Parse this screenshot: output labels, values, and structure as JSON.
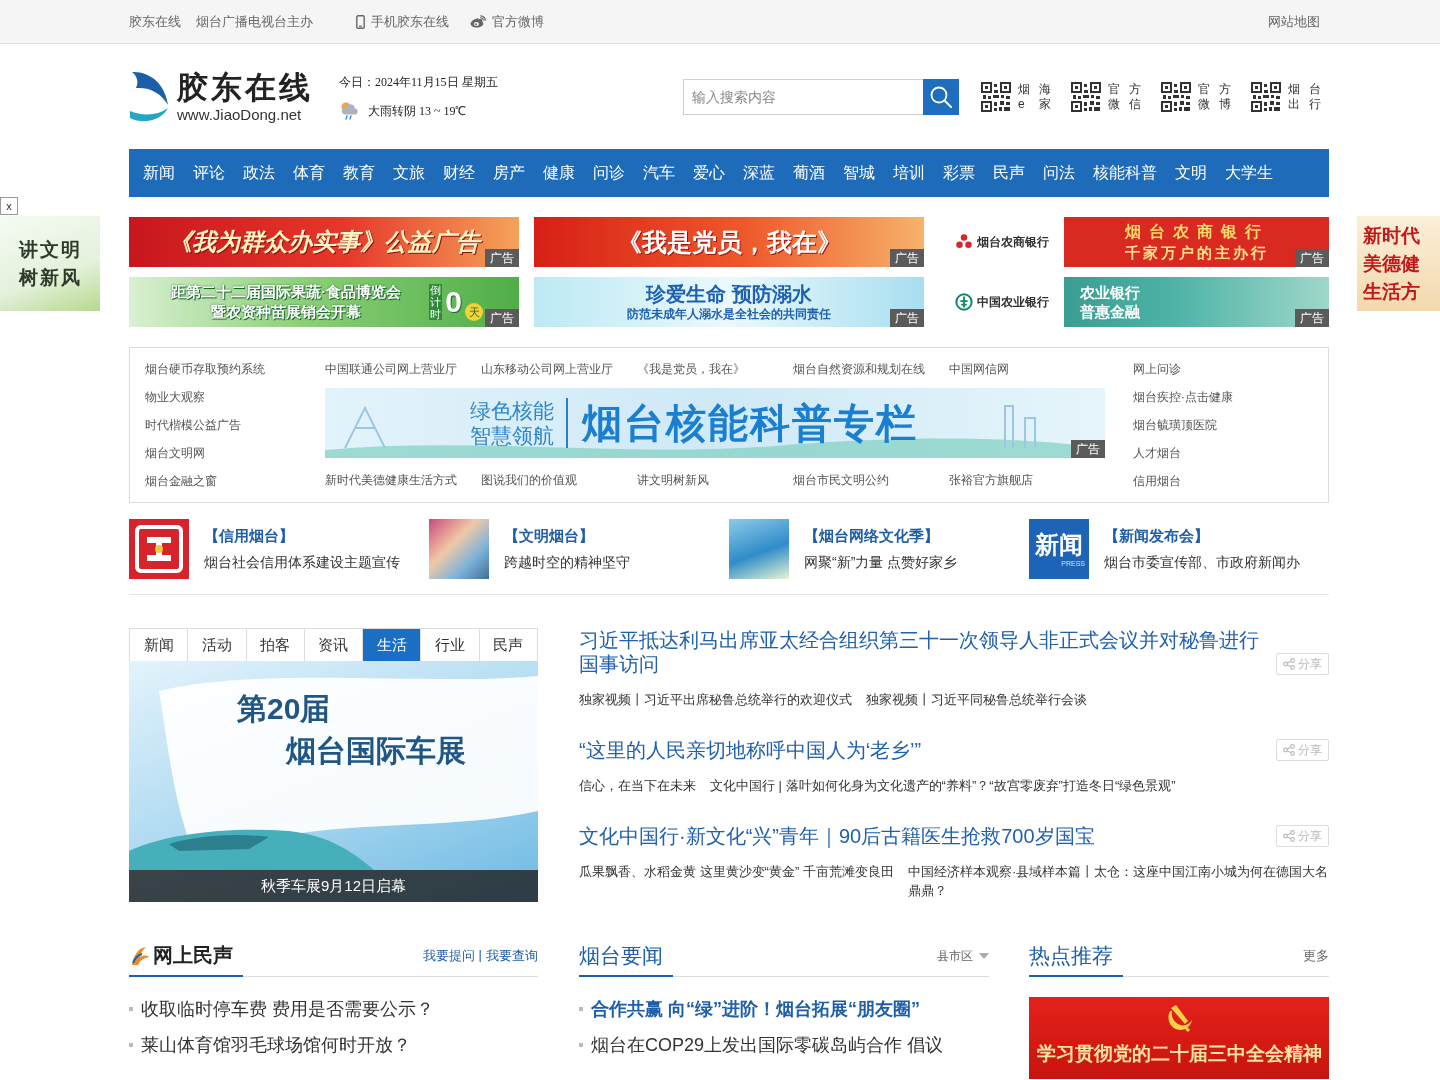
{
  "top_bar": {
    "left": [
      "胶东在线",
      "烟台广播电视台主办"
    ],
    "links": [
      {
        "kind": "mobile",
        "label": "手机胶东在线"
      },
      {
        "kind": "weibo",
        "label": "官方微博"
      }
    ],
    "sitemap": "网站地图"
  },
  "header": {
    "logo": {
      "name": "胶东在线",
      "url": "www.JiaoDong.net"
    },
    "date": "今日：2024年11月15日 星期五",
    "weather": "大雨转阴 13 ~ 19℃",
    "search": {
      "placeholder": "输入搜索内容"
    },
    "qr_codes": [
      {
        "label": "烟海e家"
      },
      {
        "label": "官方微信"
      },
      {
        "label": "官方微博"
      },
      {
        "label": "烟台出行"
      }
    ]
  },
  "nav": [
    "新闻",
    "评论",
    "政法",
    "体育",
    "教育",
    "文旅",
    "财经",
    "房产",
    "健康",
    "问诊",
    "汽车",
    "爱心",
    "深蓝",
    "葡酒",
    "智城",
    "培训",
    "彩票",
    "民声",
    "问法",
    "核能科普",
    "文明",
    "大学生"
  ],
  "float_ads": [
    {
      "kind": "left",
      "lines": [
        "讲文明",
        "树新风"
      ],
      "close": "x"
    },
    {
      "kind": "right",
      "lines": [
        "新时代",
        "美德健",
        "生活方"
      ]
    }
  ],
  "banners": [
    {
      "kind": "service",
      "lines": [
        "《我为群众办实事》公益广告"
      ],
      "tag": "广告"
    },
    {
      "kind": "party",
      "lines": [
        "《我是党员，我在》"
      ],
      "tag": "广告"
    },
    {
      "kind": "ruralbank",
      "logo": "烟台农商银行",
      "lines": [
        "烟台农商银行",
        "千家万户的主办行"
      ],
      "tag": "广告"
    },
    {
      "kind": "expo",
      "lines": [
        "距第二十二届国际果蔬·食品博览会",
        "暨农资种苗展销会开幕"
      ],
      "countdown": {
        "label": "倒计时",
        "number": "0",
        "unit": "天"
      },
      "tag": "广告"
    },
    {
      "kind": "safety",
      "lines": [
        "珍爱生命 预防溺水",
        "防范未成年人溺水是全社会的共同责任"
      ],
      "tag": "广告"
    },
    {
      "kind": "agribank",
      "logo": "中国农业银行",
      "lines": [
        "农业银行",
        "普惠金融"
      ],
      "tag": "广告"
    }
  ],
  "link_box": {
    "left": [
      "烟台硬币存取预约系统",
      "物业大观察",
      "时代楷模公益广告",
      "烟台文明网",
      "烟台金融之窗"
    ],
    "top": [
      "中国联通公司网上营业厅",
      "山东移动公司网上营业厅",
      "《我是党员，我在》",
      "烟台自然资源和规划在线",
      "中国网信网"
    ],
    "feature": {
      "lines": [
        "绿色核能",
        "智慧领航"
      ],
      "title": "烟台核能科普专栏",
      "tag": "广告"
    },
    "bottom": [
      "新时代美德健康生活方式",
      "图说我们的价值观",
      "讲文明树新风",
      "烟台市民文明公约",
      "张裕官方旗舰店"
    ],
    "right": [
      "网上问诊",
      "烟台疾控·点击健康",
      "烟台毓璜顶医院",
      "人才烟台",
      "信用烟台"
    ]
  },
  "features": [
    {
      "title": "【信用烟台】",
      "desc": "烟台社会信用体系建设主题宣传",
      "thumb": {
        "kind": "logo"
      }
    },
    {
      "title": "【文明烟台】",
      "desc": "跨越时空的精神坚守",
      "thumb": {
        "kind": "photo"
      }
    },
    {
      "title": "【烟台网络文化季】",
      "desc": "网聚“新”力量 点赞好家乡",
      "thumb": {
        "kind": "photo"
      }
    },
    {
      "title": "【新闻发布会】",
      "desc": "烟台市委宣传部、市政府新闻办",
      "thumb": {
        "kind": "text",
        "lines": [
          "新闻",
          "PRESS"
        ]
      }
    }
  ],
  "slideshow": {
    "tabs": [
      {
        "label": "新闻",
        "selected": false
      },
      {
        "label": "活动",
        "selected": false
      },
      {
        "label": "拍客",
        "selected": false
      },
      {
        "label": "资讯",
        "selected": false
      },
      {
        "label": "生活",
        "selected": true
      },
      {
        "label": "行业",
        "selected": false
      },
      {
        "label": "民声",
        "selected": false
      }
    ],
    "slide": {
      "lines": [
        "第20届",
        "烟台国际车展"
      ],
      "caption": "秋季车展9月12日启幕"
    }
  },
  "headlines": [
    {
      "title": "习近平抵达利马出席亚太经合组织第三十一次领导人非正式会议并对秘鲁进行国事访问",
      "share": "分享",
      "links": [
        "独家视频丨习近平出席秘鲁总统举行的欢迎仪式",
        "独家视频丨习近平同秘鲁总统举行会谈"
      ]
    },
    {
      "title": "“这里的人民亲切地称呼中国人为‘老乡’”",
      "share": "分享",
      "links": [
        "信心，在当下在未来",
        "文化中国行 | 落叶如何化身为文化遗产的“养料”？“故宫零废弃”打造冬日“绿色景观”"
      ]
    },
    {
      "title": "文化中国行·新文化“兴”青年｜90后古籍医生抢救700岁国宝",
      "share": "分享",
      "links": [
        "瓜果飘香、水稻金黄 这里黄沙变“黄金” 千亩荒滩变良田",
        "中国经济样本观察·县域样本篇丨太仓：这座中国江南小城为何在德国大名鼎鼎？"
      ]
    }
  ],
  "sections": {
    "voice": {
      "title": "网上民声",
      "links": [
        "我要提问",
        "我要查询"
      ],
      "separator": "|",
      "items": [
        "收取临时停车费 费用是否需要公示？",
        "莱山体育馆羽毛球场馆何时开放？"
      ]
    },
    "yantai_news": {
      "title": "烟台要闻",
      "filter": "县市区",
      "items": [
        {
          "text": "合作共赢 向“绿”进阶！烟台拓展“朋友圈”",
          "featured": true
        },
        {
          "text": "烟台在COP29上发出国际零碳岛屿合作 倡议",
          "featured": false
        }
      ]
    },
    "hot": {
      "title": "热点推荐",
      "more": "更多",
      "image": {
        "text": "学习贯彻党的二十届三中全会精神"
      }
    }
  }
}
